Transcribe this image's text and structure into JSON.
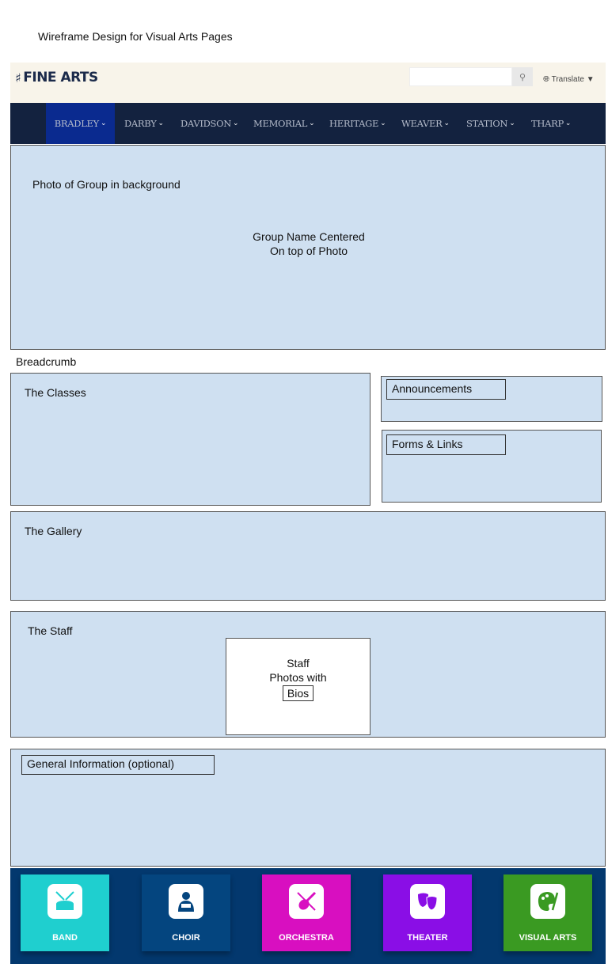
{
  "page_title": "Wireframe Design for Visual Arts Pages",
  "header": {
    "logo": "FINE ARTS",
    "search_placeholder": "",
    "translate": "Translate"
  },
  "nav": {
    "items": [
      "BRADLEY",
      "DARBY",
      "DAVIDSON",
      "MEMORIAL",
      "HERITAGE",
      "WEAVER",
      "STATION",
      "THARP"
    ],
    "active": "BRADLEY"
  },
  "hero": {
    "label": "Photo of Group in background",
    "center_line1": "Group Name Centered",
    "center_line2": "On top of Photo"
  },
  "breadcrumb": "Breadcrumb",
  "classes": "The Classes",
  "announcements": "Announcements",
  "forms_links": "Forms & Links",
  "gallery": "The Gallery",
  "staff": {
    "label": "The Staff",
    "photos_line1": "Staff",
    "photos_line2": "Photos with",
    "bios": "Bios"
  },
  "general": "General Information (optional)",
  "footer": {
    "tiles": [
      {
        "label": "BAND",
        "color": "#1fcfcf",
        "icon": "drum-icon"
      },
      {
        "label": "CHOIR",
        "color": "#04457f",
        "icon": "singer-icon"
      },
      {
        "label": "ORCHESTRA",
        "color": "#d80fc0",
        "icon": "violin-icon"
      },
      {
        "label": "THEATER",
        "color": "#8a0ee6",
        "icon": "theater-masks-icon"
      },
      {
        "label": "VISUAL ARTS",
        "color": "#3a9a22",
        "icon": "palette-icon"
      }
    ]
  }
}
